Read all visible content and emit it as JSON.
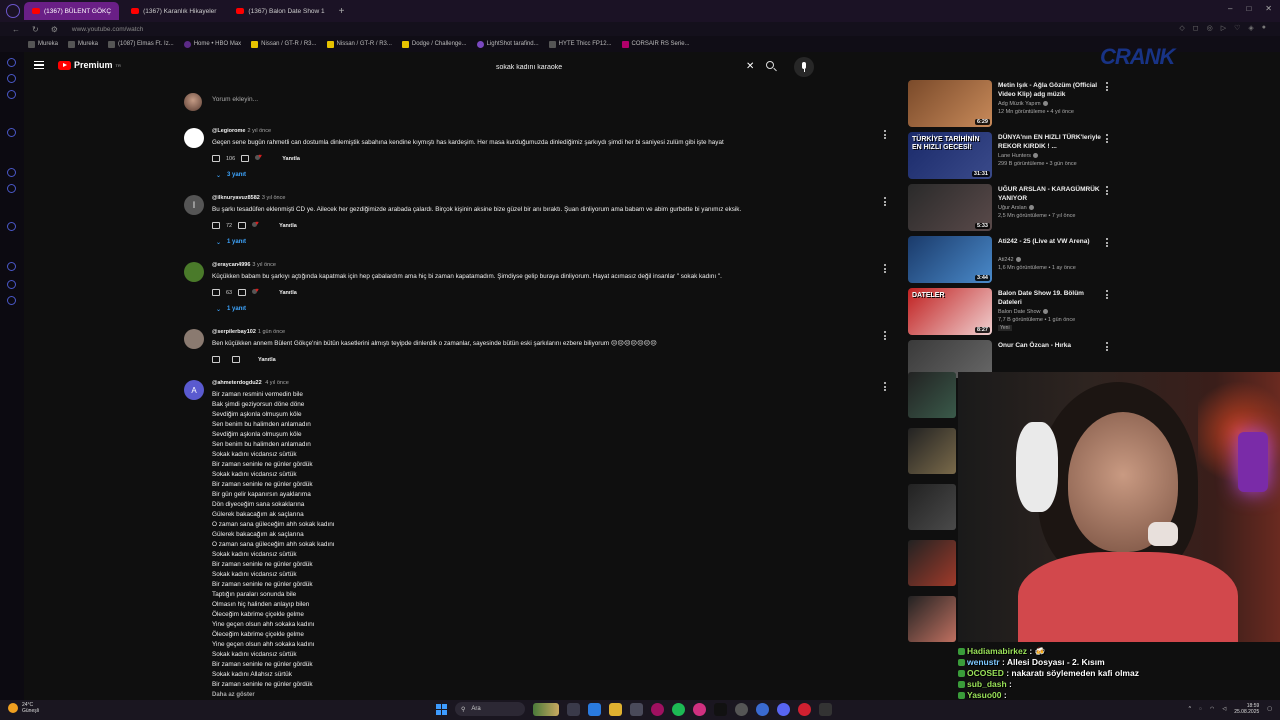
{
  "browser": {
    "tabs": [
      {
        "label": "(1367) BÜLENT GÖKÇ",
        "active": true
      },
      {
        "label": "(1367) Karanlık Hikayeler",
        "active": false
      },
      {
        "label": "(1367) Balon Date Show 1",
        "active": false
      }
    ],
    "new_tab": "+",
    "url": "www.youtube.com/watch",
    "bookmarks": [
      "Mureka",
      "Mureka",
      "(1087) Elmas Ft. Iz...",
      "Home • HBO Max",
      "Nissan / GT-R / R3...",
      "Nissan / GT-R / R3...",
      "Dodge / Challenge...",
      "LightShot tarafind...",
      "HYTE Thicc FP12...",
      "CORSAIR RS Serie..."
    ]
  },
  "youtube": {
    "logo_text": "Premium",
    "logo_sup": "TR",
    "search_value": "sokak kadını karaoke",
    "overlay_logo": "CRANK"
  },
  "comments_section": {
    "add_comment_placeholder": "Yorum ekleyin...",
    "comments": [
      {
        "author": "@Legiorome",
        "time": "2 yıl önce",
        "text": "Geçen sene bugün rahmetli can dostumla dinlemiştik sabahına kendine kıymıştı has kardeşim.  Her masa kurduğumuzda dinlediğimiz şarkıydı şimdi her bi saniyesi zulüm gibi işte hayat",
        "likes": "106",
        "reply": "Yanıtla",
        "replies": "3 yanıt",
        "avatar_color": "#ffffff",
        "avatar_letter": ""
      },
      {
        "author": "@ilknuryavuz8582",
        "time": "3 yıl önce",
        "text": "Bu şarkı tesadüfen eklenmişti CD ye. Ailecek her gezdiğimizde arabada çalardı. Birçok kişinin aksine bize güzel bir anı bıraktı. Şuan dinliyorum ama babam ve abim gurbette bi yanımız eksik.",
        "likes": "72",
        "reply": "Yanıtla",
        "replies": "1 yanıt",
        "avatar_color": "#555555",
        "avatar_letter": "İ"
      },
      {
        "author": "@eraycan4996",
        "time": "3 yıl önce",
        "text": "Küçükken babam bu şarkıyı açtığında kapatmak için hep çabalardım ama hiç bi zaman kapatamadım. Şimdiyse gelip buraya dinliyorum. Hayat acımasız değil insanlar \" sokak kadını \".",
        "likes": "63",
        "reply": "Yanıtla",
        "replies": "1 yanıt",
        "avatar_color": "#4a7a2a",
        "avatar_letter": ""
      },
      {
        "author": "@serpilerbay102",
        "time": "1 gün önce",
        "text": "Ben küçükken annem Bülent Gökçe'nin bütün kasetlerini almıştı teyipde dinlerdik o zamanlar, sayesinde bütün  eski şarkılarını ezbere biliyorum 😔😔😔😔😔😔😔",
        "likes": "",
        "reply": "Yanıtla",
        "replies": "",
        "avatar_color": "#8a7a70",
        "avatar_letter": ""
      }
    ],
    "lyrics_comment": {
      "author": "@ahmeterdogdu22",
      "time": "4 yıl önce",
      "avatar_letter": "A",
      "lines": [
        "Bir zaman resmini vermedin bile",
        "Bak şimdi geziyorsun döne döne",
        "Sevdiğim aşkınla olmuşum köle",
        "Sen benim bu halimden anlamadın",
        "Sevdiğim aşkınla olmuşum köle",
        "Sen benim bu halimden anlamadın",
        "Sokak kadını vicdansız sürtük",
        "Bir zaman seninle ne günler gördük",
        "Sokak kadını vicdansız sürtük",
        "Bir zaman seninle ne günler gördük",
        "Bir gün gelir kapanırsın ayaklarıma",
        "Dön diyeceğim sana sokaklarına",
        "Gülerek bakacağım ak saçlarına",
        "O zaman sana güleceğim ahh sokak kadını",
        "Gülerek bakacağım ak saçlarına",
        "O zaman sana güleceğim ahh sokak kadını",
        "Sokak kadını vicdansız sürtük",
        "Bir zaman seninle ne günler gördük",
        "Sokak kadını vicdansız sürtük",
        "Bir zaman seninle ne günler gördük",
        "Taptığın paraları sonunda bile",
        "Olmasın hiç halinden anlayıp bilen",
        "Öleceğim kabrime çiçekle gelme",
        "Yine geçen olsun ahh sokaka kadını",
        "Öleceğim kabrime çiçekle gelme",
        "Yine geçen olsun ahh sokaka kadını",
        "Sokak kadını vicdansız sürtük",
        "Bir zaman seninle ne günler gördük",
        "Sokak kadını Allahsız sürtük",
        "Bir zaman seninle ne günler gördük"
      ],
      "show_less": "Daha az göster"
    }
  },
  "related": [
    {
      "title": "Metin Işık - Ağla Gözüm (Official Video Klip) adg müzik",
      "channel": "Adg Müzik Yapım",
      "meta": "12 Mn görüntüleme • 4 yıl önce",
      "duration": "6:29",
      "color1": "#7a4a2a",
      "color2": "#c88a5a"
    },
    {
      "title": "DÜNYA'nın EN HIZLI TÜRK'leriyle REKOR KIRDIK ! ...",
      "channel": "Lane Hunters",
      "meta": "299 B görüntüleme • 3 gün önce",
      "duration": "31:31",
      "thumb_text": "TÜRKİYE TARİHİNİN EN HIZLI GECESİ!",
      "color1": "#1a2a6a",
      "color2": "#3a4a8a"
    },
    {
      "title": "UĞUR ARSLAN - KARAGÜMRÜK YANIYOR",
      "channel": "Uğur Arslan",
      "meta": "2,5 Mn görüntüleme • 7 yıl önce",
      "duration": "5:33",
      "color1": "#2a2a2a",
      "color2": "#5a4a4a"
    },
    {
      "title": "Ati242 - 25 (Live at VW Arena)",
      "channel": "Ati242",
      "meta": "1,6 Mn görüntüleme • 1 ay önce",
      "duration": "3:44",
      "color1": "#1a3a6a",
      "color2": "#4a8aca"
    },
    {
      "title": "Balon Date Show 19. Bölüm Dateleri",
      "channel": "Balon Date Show",
      "meta": "7,7 B görüntüleme • 1 gün önce",
      "badge": "Yeni",
      "duration": "8:27",
      "thumb_text": "DATELER",
      "color1": "#c02020",
      "color2": "#f0d0d0"
    },
    {
      "title": "Onur Can Özcan - Hırka",
      "channel": "",
      "meta": "",
      "duration": "",
      "color1": "#3a3a3a",
      "color2": "#6a6a6a"
    }
  ],
  "mini_thumbs": [
    "#3a5a4a",
    "#7a6a4a",
    "#4a4a4a",
    "#a03a2a",
    "#c07060"
  ],
  "chat": [
    {
      "user": "Hadiamabirkez",
      "sep": " :",
      "msg": " 🍻",
      "user_style": "green"
    },
    {
      "user": "wenustr",
      "sep": " :",
      "msg": " Allesi Dosyası - 2. Kısım",
      "user_style": "blue"
    },
    {
      "user": "OCOSED",
      "sep": " :",
      "msg": " nakaratı söylemeden kafi olmaz",
      "user_style": "green"
    },
    {
      "user": "sub_dash",
      "sep": " :",
      "msg": "",
      "user_style": "green"
    },
    {
      "user": "Yasuo00",
      "sep": " :",
      "msg": "",
      "user_style": "green"
    }
  ],
  "taskbar": {
    "temp": "24°C",
    "weather": "Güneşli",
    "search_label": "Ara",
    "time": "18:59",
    "date": "25.08.2025"
  }
}
